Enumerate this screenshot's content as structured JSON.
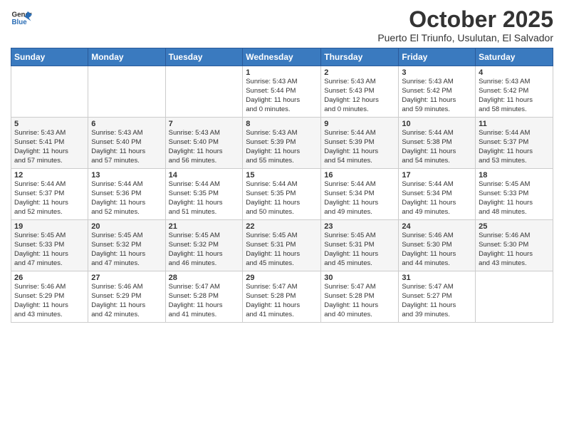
{
  "header": {
    "logo_line1": "General",
    "logo_line2": "Blue",
    "month": "October 2025",
    "location": "Puerto El Triunfo, Usulutan, El Salvador"
  },
  "days_of_week": [
    "Sunday",
    "Monday",
    "Tuesday",
    "Wednesday",
    "Thursday",
    "Friday",
    "Saturday"
  ],
  "weeks": [
    [
      {
        "day": "",
        "info": ""
      },
      {
        "day": "",
        "info": ""
      },
      {
        "day": "",
        "info": ""
      },
      {
        "day": "1",
        "info": "Sunrise: 5:43 AM\nSunset: 5:44 PM\nDaylight: 11 hours\nand 0 minutes."
      },
      {
        "day": "2",
        "info": "Sunrise: 5:43 AM\nSunset: 5:43 PM\nDaylight: 12 hours\nand 0 minutes."
      },
      {
        "day": "3",
        "info": "Sunrise: 5:43 AM\nSunset: 5:42 PM\nDaylight: 11 hours\nand 59 minutes."
      },
      {
        "day": "4",
        "info": "Sunrise: 5:43 AM\nSunset: 5:42 PM\nDaylight: 11 hours\nand 58 minutes."
      }
    ],
    [
      {
        "day": "5",
        "info": "Sunrise: 5:43 AM\nSunset: 5:41 PM\nDaylight: 11 hours\nand 57 minutes."
      },
      {
        "day": "6",
        "info": "Sunrise: 5:43 AM\nSunset: 5:40 PM\nDaylight: 11 hours\nand 57 minutes."
      },
      {
        "day": "7",
        "info": "Sunrise: 5:43 AM\nSunset: 5:40 PM\nDaylight: 11 hours\nand 56 minutes."
      },
      {
        "day": "8",
        "info": "Sunrise: 5:43 AM\nSunset: 5:39 PM\nDaylight: 11 hours\nand 55 minutes."
      },
      {
        "day": "9",
        "info": "Sunrise: 5:44 AM\nSunset: 5:39 PM\nDaylight: 11 hours\nand 54 minutes."
      },
      {
        "day": "10",
        "info": "Sunrise: 5:44 AM\nSunset: 5:38 PM\nDaylight: 11 hours\nand 54 minutes."
      },
      {
        "day": "11",
        "info": "Sunrise: 5:44 AM\nSunset: 5:37 PM\nDaylight: 11 hours\nand 53 minutes."
      }
    ],
    [
      {
        "day": "12",
        "info": "Sunrise: 5:44 AM\nSunset: 5:37 PM\nDaylight: 11 hours\nand 52 minutes."
      },
      {
        "day": "13",
        "info": "Sunrise: 5:44 AM\nSunset: 5:36 PM\nDaylight: 11 hours\nand 52 minutes."
      },
      {
        "day": "14",
        "info": "Sunrise: 5:44 AM\nSunset: 5:35 PM\nDaylight: 11 hours\nand 51 minutes."
      },
      {
        "day": "15",
        "info": "Sunrise: 5:44 AM\nSunset: 5:35 PM\nDaylight: 11 hours\nand 50 minutes."
      },
      {
        "day": "16",
        "info": "Sunrise: 5:44 AM\nSunset: 5:34 PM\nDaylight: 11 hours\nand 49 minutes."
      },
      {
        "day": "17",
        "info": "Sunrise: 5:44 AM\nSunset: 5:34 PM\nDaylight: 11 hours\nand 49 minutes."
      },
      {
        "day": "18",
        "info": "Sunrise: 5:45 AM\nSunset: 5:33 PM\nDaylight: 11 hours\nand 48 minutes."
      }
    ],
    [
      {
        "day": "19",
        "info": "Sunrise: 5:45 AM\nSunset: 5:33 PM\nDaylight: 11 hours\nand 47 minutes."
      },
      {
        "day": "20",
        "info": "Sunrise: 5:45 AM\nSunset: 5:32 PM\nDaylight: 11 hours\nand 47 minutes."
      },
      {
        "day": "21",
        "info": "Sunrise: 5:45 AM\nSunset: 5:32 PM\nDaylight: 11 hours\nand 46 minutes."
      },
      {
        "day": "22",
        "info": "Sunrise: 5:45 AM\nSunset: 5:31 PM\nDaylight: 11 hours\nand 45 minutes."
      },
      {
        "day": "23",
        "info": "Sunrise: 5:45 AM\nSunset: 5:31 PM\nDaylight: 11 hours\nand 45 minutes."
      },
      {
        "day": "24",
        "info": "Sunrise: 5:46 AM\nSunset: 5:30 PM\nDaylight: 11 hours\nand 44 minutes."
      },
      {
        "day": "25",
        "info": "Sunrise: 5:46 AM\nSunset: 5:30 PM\nDaylight: 11 hours\nand 43 minutes."
      }
    ],
    [
      {
        "day": "26",
        "info": "Sunrise: 5:46 AM\nSunset: 5:29 PM\nDaylight: 11 hours\nand 43 minutes."
      },
      {
        "day": "27",
        "info": "Sunrise: 5:46 AM\nSunset: 5:29 PM\nDaylight: 11 hours\nand 42 minutes."
      },
      {
        "day": "28",
        "info": "Sunrise: 5:47 AM\nSunset: 5:28 PM\nDaylight: 11 hours\nand 41 minutes."
      },
      {
        "day": "29",
        "info": "Sunrise: 5:47 AM\nSunset: 5:28 PM\nDaylight: 11 hours\nand 41 minutes."
      },
      {
        "day": "30",
        "info": "Sunrise: 5:47 AM\nSunset: 5:28 PM\nDaylight: 11 hours\nand 40 minutes."
      },
      {
        "day": "31",
        "info": "Sunrise: 5:47 AM\nSunset: 5:27 PM\nDaylight: 11 hours\nand 39 minutes."
      },
      {
        "day": "",
        "info": ""
      }
    ]
  ]
}
